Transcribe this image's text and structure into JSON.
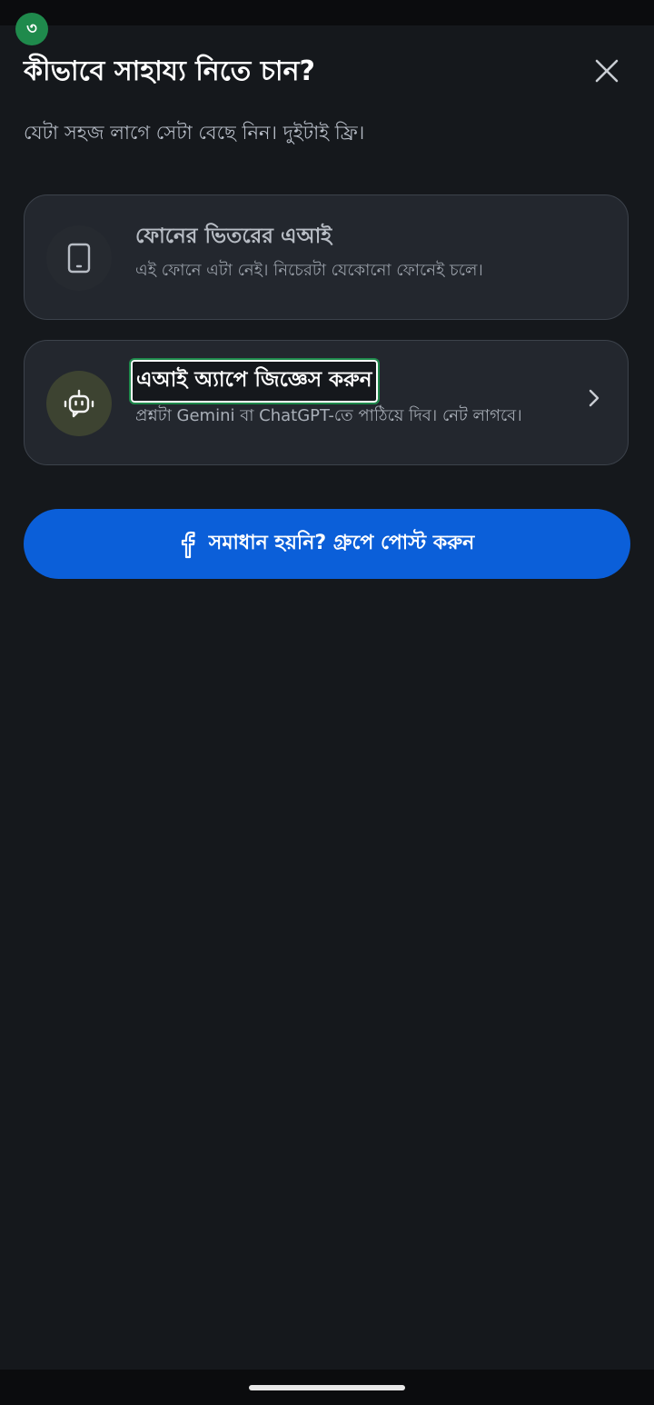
{
  "status": {},
  "step_badge": "৩",
  "header": {
    "title": "কীভাবে সাহায্য নিতে চান?",
    "subtitle": "যেটা সহজ লাগে সেটা বেছে নিন। দুইটাই ফ্রি।"
  },
  "options": [
    {
      "title": "ফোনের ভিতরের এআই",
      "description": "এই ফোনে এটা নেই। নিচেরটা যেকোনো ফোনেই চলে।",
      "icon": "phone-icon",
      "enabled": false
    },
    {
      "title": "এআই অ্যাপে জিজ্ঞেস করুন",
      "description": "প্রশ্নটা Gemini বা ChatGPT-তে পাঠিয়ে দিব। নেট লাগবে।",
      "icon": "robot-icon",
      "enabled": true
    }
  ],
  "facebook_button": {
    "label": "সমাধান হয়নি? গ্রুপে পোস্ট করুন",
    "icon": "facebook-icon"
  },
  "colors": {
    "background": "#15181c",
    "card": "#23272e",
    "accent_green": "#1f8a4c",
    "facebook_blue": "#0b5fd9"
  }
}
